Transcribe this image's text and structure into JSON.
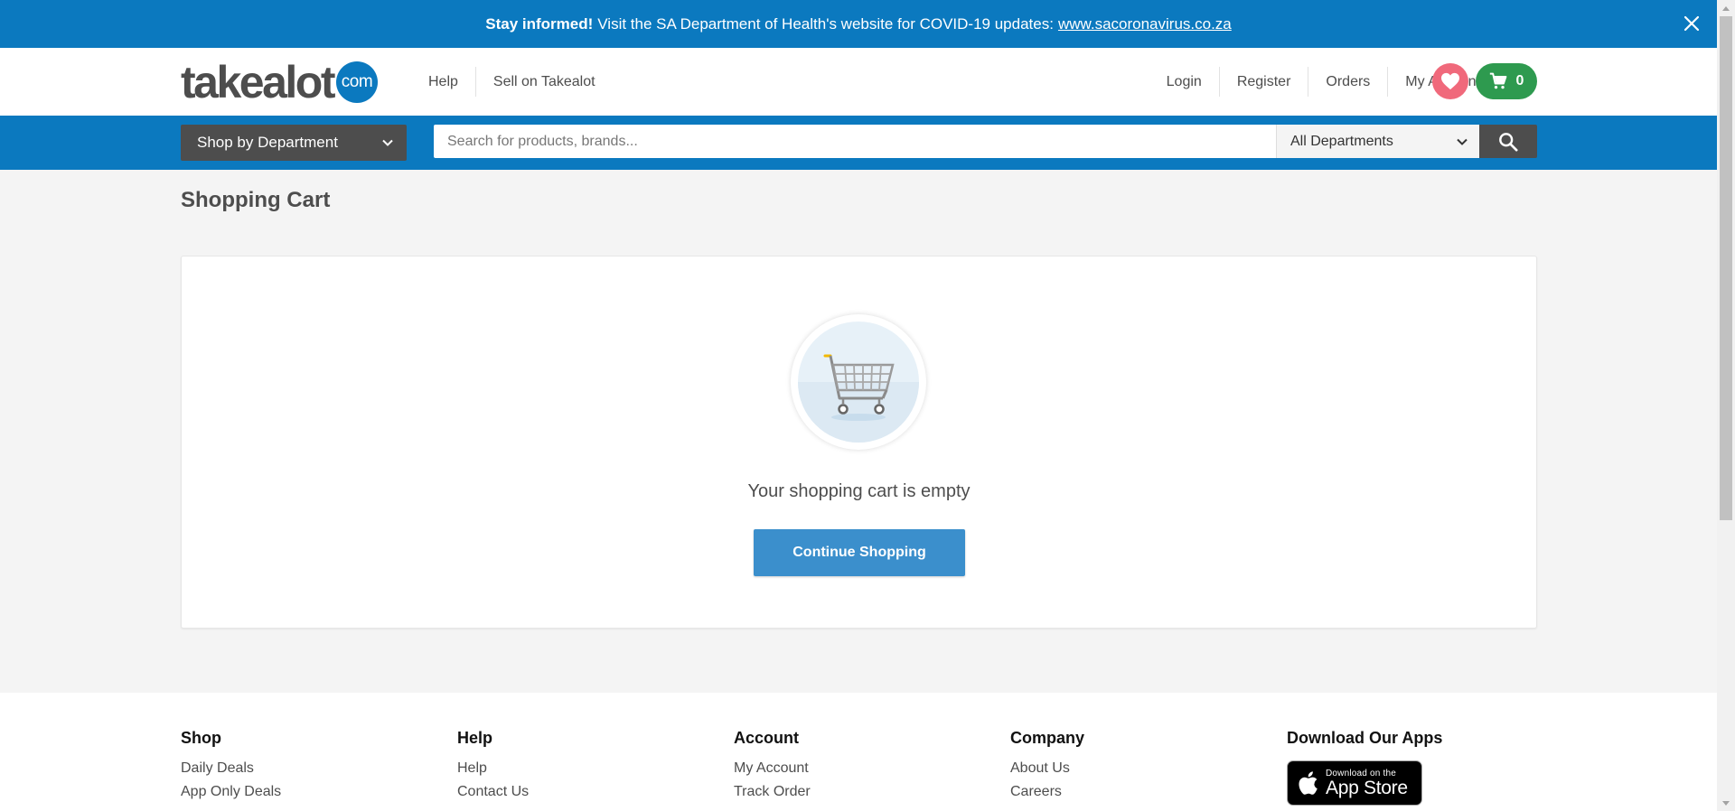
{
  "notice": {
    "bold": "Stay informed!",
    "text": "Visit the SA Department of Health's website for COVID-19 updates:",
    "link": "www.sacoronavirus.co.za"
  },
  "logo": {
    "word": "takealot",
    "suffix": "com"
  },
  "nav_left": [
    "Help",
    "Sell on Takealot"
  ],
  "nav_right": {
    "login": "Login",
    "register": "Register",
    "orders": "Orders",
    "account": "My Account"
  },
  "cart": {
    "count": "0"
  },
  "search": {
    "shop_by_department": "Shop by Department",
    "placeholder": "Search for products, brands...",
    "department": "All Departments"
  },
  "main": {
    "title": "Shopping Cart",
    "empty_message": "Your shopping cart is empty",
    "continue_label": "Continue Shopping"
  },
  "footer": {
    "shop": {
      "heading": "Shop",
      "links": [
        "Daily Deals",
        "App Only Deals"
      ]
    },
    "help": {
      "heading": "Help",
      "links": [
        "Help",
        "Contact Us"
      ]
    },
    "account": {
      "heading": "Account",
      "links": [
        "My Account",
        "Track Order"
      ]
    },
    "company": {
      "heading": "Company",
      "links": [
        "About Us",
        "Careers"
      ]
    },
    "apps": {
      "heading": "Download Our Apps",
      "badge_small": "Download on the",
      "badge_big": "App Store"
    }
  },
  "colors": {
    "brand_blue": "#0b79bf",
    "dark_grey": "#4d4d4d",
    "wishlist_pink": "#f0697b",
    "cart_green": "#2e9a4f",
    "button_blue": "#3b8fcc"
  },
  "icons": [
    "close-icon",
    "heart-icon",
    "cart-icon",
    "chevron-down-icon",
    "search-icon",
    "empty-cart-icon",
    "apple-icon"
  ]
}
